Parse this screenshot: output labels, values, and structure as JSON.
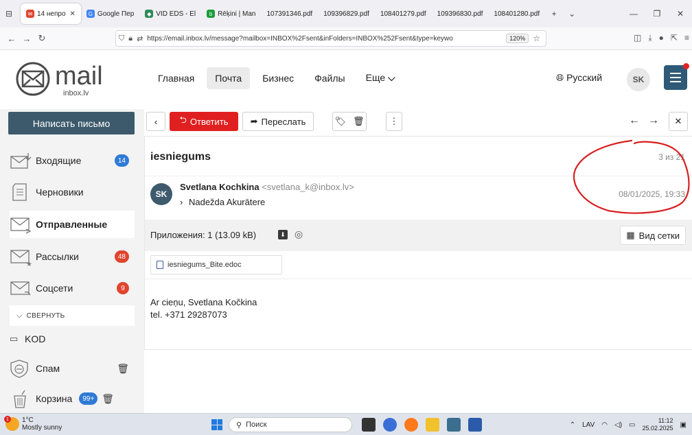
{
  "browser": {
    "tabs": [
      {
        "label": "14 непро",
        "icon_color": "#e0452f",
        "active": true
      },
      {
        "label": "Google Пер",
        "icon_color": "#4285f4",
        "active": false
      },
      {
        "label": "VID EDS - El",
        "icon_color": "#2e8b57",
        "active": false
      },
      {
        "label": "Rēķini | Man",
        "icon_color": "#1a9c3a",
        "active": false
      },
      {
        "label": "107391346.pdf",
        "icon_color": "",
        "active": false
      },
      {
        "label": "109396829.pdf",
        "icon_color": "",
        "active": false
      },
      {
        "label": "108401279.pdf",
        "icon_color": "",
        "active": false
      },
      {
        "label": "109396830.pdf",
        "icon_color": "",
        "active": false
      },
      {
        "label": "108401280.pdf",
        "icon_color": "",
        "active": false
      }
    ],
    "url": "https://email.inbox.lv/message?mailbox=INBOX%2Fsent&inFolders=INBOX%252Fsent&type=keywo",
    "zoom": "120%"
  },
  "header": {
    "logo_word": "mail",
    "logo_sub": "inbox.lv",
    "nav": [
      {
        "label": "Главная",
        "active": false
      },
      {
        "label": "Почта",
        "active": true
      },
      {
        "label": "Бизнес",
        "active": false
      },
      {
        "label": "Файлы",
        "active": false
      },
      {
        "label": "Еще",
        "active": false
      }
    ],
    "language": "Русский",
    "user_initials": "SK"
  },
  "sidebar": {
    "compose": "Написать письмо",
    "folders": [
      {
        "label": "Входящие",
        "count": "14",
        "count_color": "blue",
        "active": false
      },
      {
        "label": "Черновики",
        "count": "",
        "count_color": "",
        "active": false
      },
      {
        "label": "Отправленные",
        "count": "",
        "count_color": "",
        "active": true
      },
      {
        "label": "Рассылки",
        "count": "48",
        "count_color": "red",
        "active": false
      },
      {
        "label": "Соцсети",
        "count": "9",
        "count_color": "red",
        "active": false
      }
    ],
    "collapse": "СВЕРНУТЬ",
    "kod": "KOD",
    "spam": "Спам",
    "trash": "Корзина",
    "trash_count": "99+"
  },
  "toolbar": {
    "reply": "Ответить",
    "forward": "Переслать"
  },
  "message": {
    "subject": "iesniegums",
    "counter": "3 из 21",
    "sender_initials": "SK",
    "sender_name": "Svetlana Kochkina",
    "sender_email": "<svetlana_k@inbox.lv>",
    "recipient": "Nadežda Akurātere",
    "date": "08/01/2025, 19:33",
    "attachments_label": "Приложения: 1 (13.09 kB)",
    "grid_view": "Вид сетки",
    "file_name": "iesniegums_Bite.edoc",
    "body_line1": "Ar cieņu, Svetlana Kočkina",
    "body_line2": "tel. +371 29287073"
  },
  "taskbar": {
    "temperature": "1°C",
    "weather": "Mostly sunny",
    "search": "Поиск",
    "lang": "LAV",
    "time": "11:12",
    "date": "25.02.2025",
    "weather_badge": "1"
  }
}
